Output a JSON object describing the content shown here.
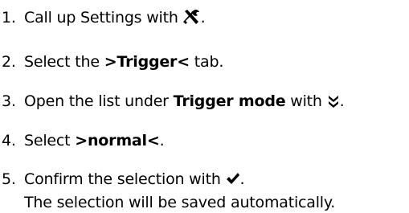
{
  "steps": [
    {
      "number": "1.",
      "text_before": "Call up Settings with ",
      "icon": "tools-icon",
      "text_after": "."
    },
    {
      "number": "2.",
      "text_before": "Select the ",
      "bold": ">Trigger<",
      "text_after": " tab."
    },
    {
      "number": "3.",
      "text_before": "Open the list under ",
      "bold": "Trigger mode",
      "text_middle": " with ",
      "icon": "chevron-double-down-icon",
      "text_after": "."
    },
    {
      "number": "4.",
      "text_before": "Select ",
      "bold": ">normal<",
      "text_after": "."
    },
    {
      "number": "5.",
      "text_before": "Confirm the selection with ",
      "icon": "checkmark-icon",
      "text_after": ".",
      "note": "The selection will be saved automatically."
    }
  ]
}
